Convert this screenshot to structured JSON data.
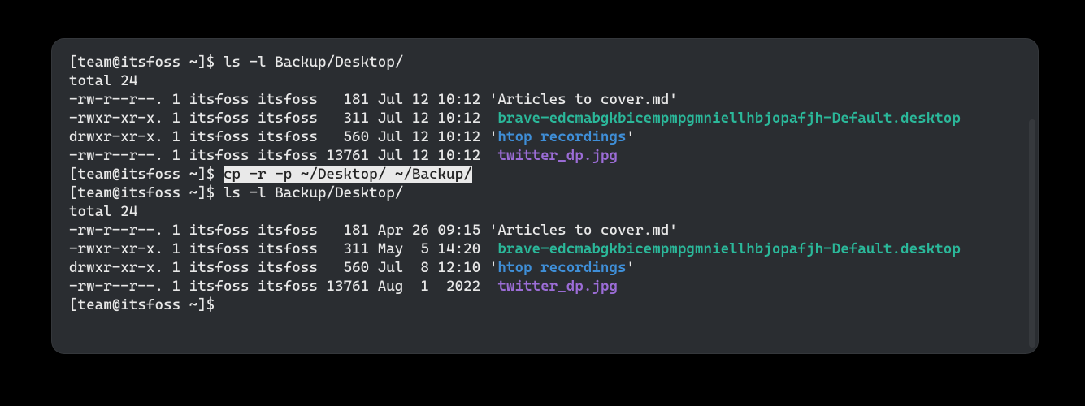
{
  "prompt": "[team@itsfoss ~]$ ",
  "cmd1": "ls -l Backup/Desktop/",
  "listing1": {
    "total": "total 24",
    "rows": [
      {
        "perm": "-rw-r--r--.",
        "links": "1",
        "owner": "itsfoss",
        "group": "itsfoss",
        "size": "  181",
        "date": "Jul 12 10:12",
        "pre": "'",
        "name": "Articles to cover.md",
        "post": "'",
        "color": "default"
      },
      {
        "perm": "-rwxr-xr-x.",
        "links": "1",
        "owner": "itsfoss",
        "group": "itsfoss",
        "size": "  311",
        "date": "Jul 12 10:12",
        "pre": " ",
        "name": "brave-edcmabgkbicempmpgmniellhbjopafjh-Default.desktop",
        "post": "",
        "color": "green"
      },
      {
        "perm": "drwxr-xr-x.",
        "links": "1",
        "owner": "itsfoss",
        "group": "itsfoss",
        "size": "  560",
        "date": "Jul 12 10:12",
        "pre": "'",
        "name": "htop recordings",
        "post": "'",
        "color": "blue"
      },
      {
        "perm": "-rw-r--r--.",
        "links": "1",
        "owner": "itsfoss",
        "group": "itsfoss",
        "size": "13761",
        "date": "Jul 12 10:12",
        "pre": " ",
        "name": "twitter_dp.jpg",
        "post": "",
        "color": "magenta"
      }
    ]
  },
  "cmd2": "cp -r -p ~/Desktop/ ~/Backup/",
  "cmd3": "ls -l Backup/Desktop/",
  "listing2": {
    "total": "total 24",
    "rows": [
      {
        "perm": "-rw-r--r--.",
        "links": "1",
        "owner": "itsfoss",
        "group": "itsfoss",
        "size": "  181",
        "date": "Apr 26 09:15",
        "pre": "'",
        "name": "Articles to cover.md",
        "post": "'",
        "color": "default"
      },
      {
        "perm": "-rwxr-xr-x.",
        "links": "1",
        "owner": "itsfoss",
        "group": "itsfoss",
        "size": "  311",
        "date": "May  5 14:20",
        "pre": " ",
        "name": "brave-edcmabgkbicempmpgmniellhbjopafjh-Default.desktop",
        "post": "",
        "color": "green"
      },
      {
        "perm": "drwxr-xr-x.",
        "links": "1",
        "owner": "itsfoss",
        "group": "itsfoss",
        "size": "  560",
        "date": "Jul  8 12:10",
        "pre": "'",
        "name": "htop recordings",
        "post": "'",
        "color": "blue"
      },
      {
        "perm": "-rw-r--r--.",
        "links": "1",
        "owner": "itsfoss",
        "group": "itsfoss",
        "size": "13761",
        "date": "Aug  1  2022",
        "pre": " ",
        "name": "twitter_dp.jpg",
        "post": "",
        "color": "magenta"
      }
    ]
  }
}
